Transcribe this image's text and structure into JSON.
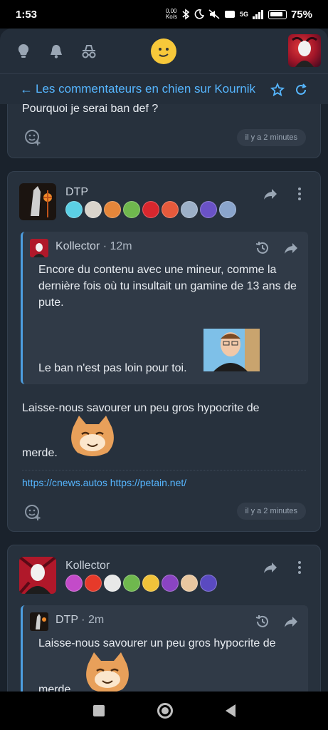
{
  "status_bar": {
    "time": "1:53",
    "net_speed": "0,00\nKo/s",
    "network": "5G",
    "battery": "75%"
  },
  "thread": {
    "title": "Les commentateurs en chien sur Kournik"
  },
  "posts": [
    {
      "text": "Pourquoi je serai ban def ?",
      "time_ago": "il y a 2 minutes"
    },
    {
      "author": "DTP",
      "quote": {
        "author": "Kollector",
        "time": "12m",
        "text_1": "Encore du contenu avec une mineur, comme la dernière fois où tu insultait un gamine de 13 ans de pute.",
        "text_2": "Le ban n'est pas loin pour toi."
      },
      "text_1": "Laisse-nous savourer un peu gros hypocrite de",
      "text_2": "merde.",
      "links": "https://cnews.autos https://petain.net/",
      "time_ago": "il y a 2 minutes"
    },
    {
      "author": "Kollector",
      "quote": {
        "author": "DTP",
        "time": "2m",
        "text_1": "Laisse-nous savourer un peu gros hypocrite de",
        "text_2": "merde."
      }
    }
  ],
  "separator": "·",
  "icon_names": [
    "lightbulb-icon",
    "bell-icon",
    "incognito-icon",
    "smiley-icon",
    "back-arrow-icon",
    "star-icon",
    "refresh-icon",
    "share-icon",
    "more-icon",
    "history-icon",
    "add-reaction-icon"
  ]
}
